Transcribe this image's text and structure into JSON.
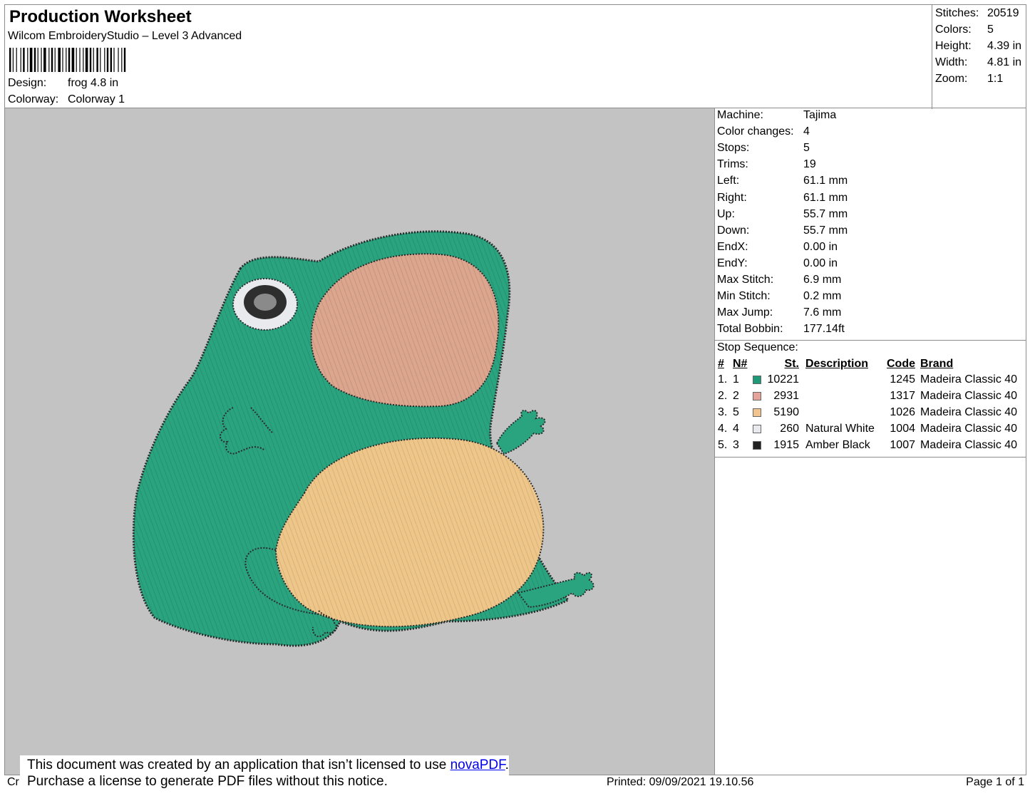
{
  "header": {
    "title": "Production Worksheet",
    "subtitle": "Wilcom EmbroideryStudio – Level 3 Advanced",
    "design_label": "Design:",
    "design_value": "frog 4.8 in",
    "colorway_label": "Colorway:",
    "colorway_value": "Colorway 1"
  },
  "summary": [
    {
      "label": "Stitches:",
      "value": "20519"
    },
    {
      "label": "Colors:",
      "value": "5"
    },
    {
      "label": "Height:",
      "value": "4.39 in"
    },
    {
      "label": "Width:",
      "value": "4.81 in"
    },
    {
      "label": "Zoom:",
      "value": "1:1"
    }
  ],
  "info": [
    {
      "label": "Machine:",
      "value": "Tajima"
    },
    {
      "label": "Color changes:",
      "value": "4"
    },
    {
      "label": "Stops:",
      "value": "5"
    },
    {
      "label": "Trims:",
      "value": "19"
    },
    {
      "label": "Left:",
      "value": "61.1 mm"
    },
    {
      "label": "Right:",
      "value": "61.1 mm"
    },
    {
      "label": "Up:",
      "value": "55.7 mm"
    },
    {
      "label": "Down:",
      "value": "55.7 mm"
    },
    {
      "label": "EndX:",
      "value": "0.00 in"
    },
    {
      "label": "EndY:",
      "value": "0.00 in"
    },
    {
      "label": "Max Stitch:",
      "value": "6.9 mm"
    },
    {
      "label": "Min Stitch:",
      "value": "0.2 mm"
    },
    {
      "label": "Max Jump:",
      "value": "7.6 mm"
    },
    {
      "label": "Total Bobbin:",
      "value": "177.14ft"
    }
  ],
  "stop_sequence": {
    "title": "Stop Sequence:",
    "headers": {
      "num": "#",
      "n": "N#",
      "st": "St.",
      "description": "Description",
      "code": "Code",
      "brand": "Brand"
    },
    "rows": [
      {
        "num": "1.",
        "n": "1",
        "color": "#1f9a78",
        "st": "10221",
        "description": "",
        "code": "1245",
        "brand": "Madeira Classic 40"
      },
      {
        "num": "2.",
        "n": "2",
        "color": "#e5a39a",
        "st": "2931",
        "description": "",
        "code": "1317",
        "brand": "Madeira Classic 40"
      },
      {
        "num": "3.",
        "n": "5",
        "color": "#f2c48e",
        "st": "5190",
        "description": "",
        "code": "1026",
        "brand": "Madeira Classic 40"
      },
      {
        "num": "4.",
        "n": "4",
        "color": "#e8eaee",
        "st": "260",
        "description": "Natural White",
        "code": "1004",
        "brand": "Madeira Classic 40"
      },
      {
        "num": "5.",
        "n": "3",
        "color": "#222222",
        "st": "1915",
        "description": "Amber Black",
        "code": "1007",
        "brand": "Madeira Classic 40"
      }
    ]
  },
  "notice": {
    "line1_prefix": "This document was created by an application that isn’t licensed to use ",
    "link": "novaPDF",
    "line1_suffix": ".",
    "line2": "Purchase a license to generate PDF files without this notice."
  },
  "footer": {
    "left": "Cr",
    "printed": "Printed: 09/09/2021 19.10.56",
    "page": "Page 1 of 1"
  },
  "colors": {
    "preview_bg": "#c3c3c3",
    "frog_green": "#2aa37f",
    "frog_cheek": "#dba58e",
    "frog_belly": "#efc689",
    "outline": "#2b2b2b"
  }
}
